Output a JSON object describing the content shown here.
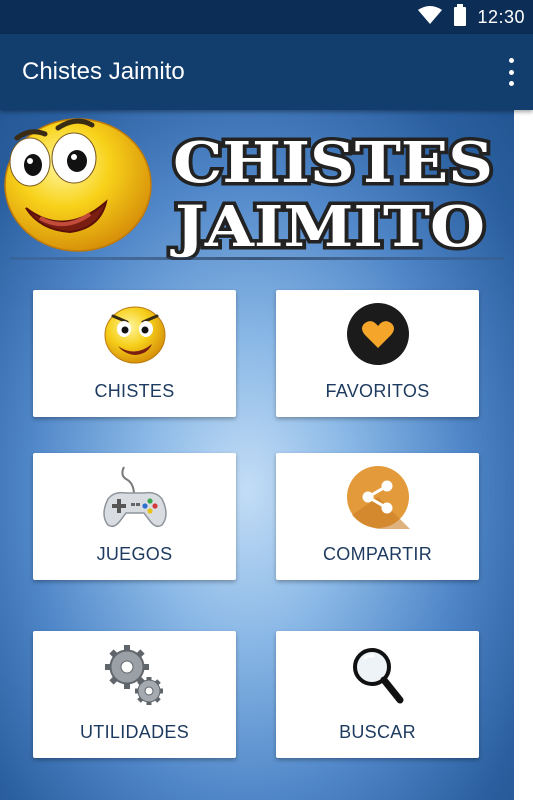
{
  "status_bar": {
    "time": "12:30"
  },
  "app_bar": {
    "title": "Chistes Jaimito"
  },
  "banner": {
    "line1": "CHISTES",
    "line2": "JAIMITO"
  },
  "menu": [
    {
      "label": "CHISTES",
      "icon": "smiley-face-icon"
    },
    {
      "label": "FAVORITOS",
      "icon": "heart-icon"
    },
    {
      "label": "JUEGOS",
      "icon": "gamepad-icon"
    },
    {
      "label": "COMPARTIR",
      "icon": "share-icon"
    },
    {
      "label": "UTILIDADES",
      "icon": "gears-icon"
    },
    {
      "label": "BUSCAR",
      "icon": "magnifier-icon"
    }
  ],
  "colors": {
    "status_bar": "#0c2d55",
    "app_bar": "#123e6e",
    "heart": "#f4a52a",
    "share_circle": "#e39a3a",
    "label_text": "#1d3a5f"
  }
}
